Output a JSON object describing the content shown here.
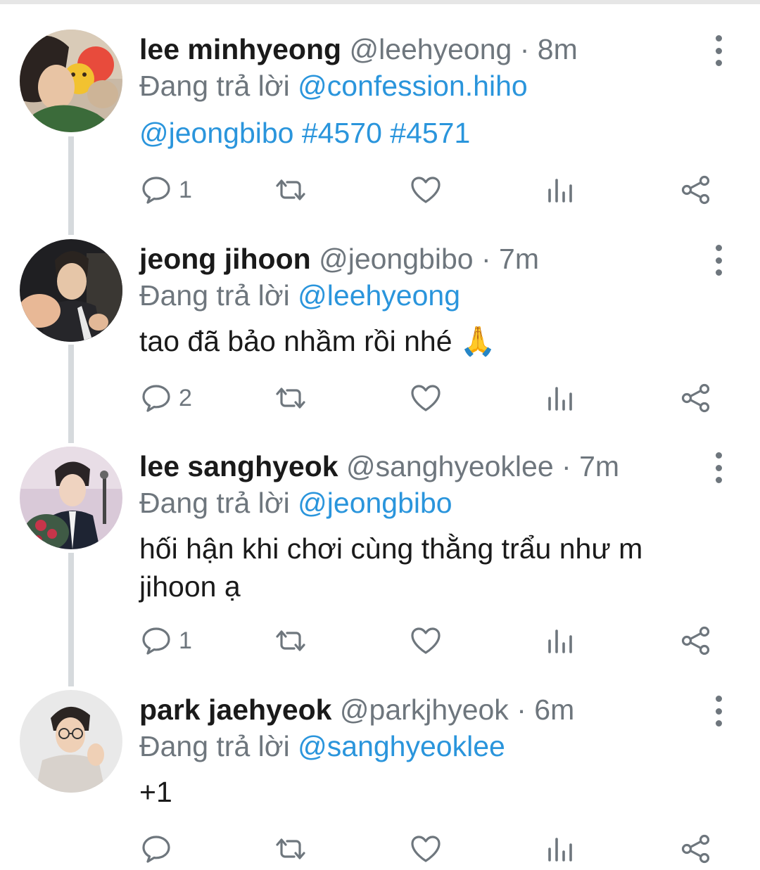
{
  "thread": [
    {
      "name": "lee minhyeong",
      "handle": "@leehyeong",
      "separator": "·",
      "time": "8m",
      "reply_prefix": "Đang trả lời",
      "reply_to": "@confession.hiho",
      "body_mention": "@jeongbibo",
      "body_tags": "#4570 #4571",
      "reply_count": "1"
    },
    {
      "name": "jeong jihoon",
      "handle": "@jeongbibo",
      "separator": "·",
      "time": "7m",
      "reply_prefix": "Đang trả lời",
      "reply_to": "@leehyeong",
      "body_text": "tao đã bảo nhầm rồi nhé",
      "body_emoji": "🙏",
      "reply_count": "2"
    },
    {
      "name": "lee sanghyeok",
      "handle": "@sanghyeoklee",
      "separator": "·",
      "time": "7m",
      "reply_prefix": "Đang trả lời",
      "reply_to": "@jeongbibo",
      "body_line1": "hối hận khi chơi cùng thằng trẩu như m",
      "body_line2": "jihoon ạ",
      "reply_count": "1"
    },
    {
      "name": "park jaehyeok",
      "handle": "@parkjhyeok",
      "separator": "·",
      "time": "6m",
      "reply_prefix": "Đang trả lời",
      "reply_to": "@sanghyeoklee",
      "body_text": "+1",
      "reply_count": ""
    }
  ],
  "icons": {
    "reply": "speech-bubble-icon",
    "retweet": "retweet-icon",
    "like": "heart-icon",
    "stats": "bar-chart-icon",
    "share": "share-icon",
    "more": "vertical-dots-icon"
  },
  "colors": {
    "link": "#2a95dc",
    "muted": "#6e767d",
    "text": "#1a1a1a",
    "thread_line": "#d6dadd"
  }
}
